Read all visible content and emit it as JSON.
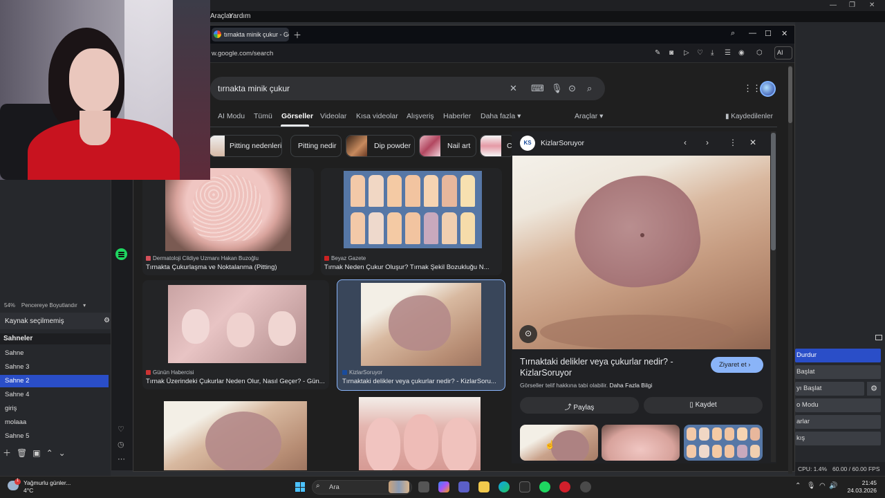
{
  "obs": {
    "menu": [
      "Araçlar",
      "Yardım"
    ],
    "zoom_pct": "54%",
    "zoom_mode": "Pencereye Boyutlandır",
    "source_status": "Kaynak seçilmemiş",
    "scenes_header": "Sahneler",
    "scenes": [
      "Sahne",
      "Sahne 3",
      "Sahne 2",
      "Sahne 4",
      "giriş",
      "molaaa",
      "Sahne 5"
    ],
    "selected_scene": "Sahne 2",
    "controls": [
      "Durdur",
      "Başlat",
      "yı Başlat",
      "o Modu",
      "arlar",
      "kış"
    ],
    "cpu": "CPU: 1.4%",
    "fps": "60.00 / 60.00 FPS"
  },
  "browser": {
    "tab_title": "tırnakta minik çukur - Goo",
    "url": "w.google.com/search",
    "ai_label": "AI"
  },
  "google": {
    "query": "tırnakta minik çukur",
    "tabs": [
      "AI Modu",
      "Tümü",
      "Görseller",
      "Videolar",
      "Kısa videolar",
      "Alışveriş",
      "Haberler",
      "Daha fazla"
    ],
    "active_tab": "Görseller",
    "tools": "Araçlar",
    "saved": "Kaydedilenler",
    "chips": [
      "Pitting nedenleri",
      "Pitting nedir",
      "Dip powder",
      "Nail art",
      "Co"
    ],
    "results": [
      {
        "source": "Dermatoloji Cildiye Uzmanı Hakan Buzoğlu",
        "title": "Tırnakta Çukurlaşma ve Noktalanma (Pitting)"
      },
      {
        "source": "Beyaz Gazete",
        "title": "Tırnak Neden Çukur Oluşur? Tırnak Şekil Bozukluğu N..."
      },
      {
        "source": "Günün Habercisi",
        "title": "Tırnak Üzerindeki Çukurlar Neden Olur, Nasıl Geçer? - Gün..."
      },
      {
        "source": "KizlarSoruyor",
        "title": "Tırnaktaki delikler veya çukurlar nedir? - KizlarSoru..."
      }
    ],
    "panel": {
      "site": "KizlarSoruyor",
      "logo_text": "KS",
      "title": "Tırnaktaki delikler veya çukurlar nedir? - KizlarSoruyor",
      "copyright_note": "Görseller telif hakkına tabi olabilir.",
      "more_info": "Daha Fazla Bilgi",
      "visit": "Ziyaret et",
      "share": "Paylaş",
      "save": "Kaydet"
    }
  },
  "taskbar": {
    "weather_title": "Yağmurlu günler...",
    "weather_temp": "4°C",
    "weather_badge": "1",
    "search_placeholder": "Ara",
    "time": "21:45",
    "date": "24.03.2026"
  },
  "colors": {
    "accent_blue": "#2a4ec8",
    "google_link": "#8ab4f8",
    "spotify_green": "#1ed760"
  }
}
